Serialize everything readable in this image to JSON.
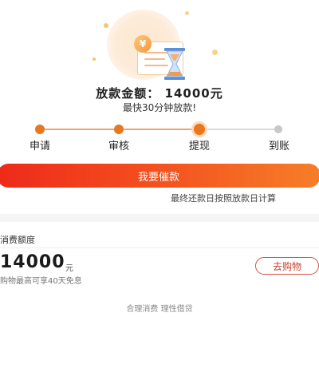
{
  "loan": {
    "amount_title": "放款金额：  14000元",
    "speed_note": "最快30分钟放款!"
  },
  "steps": [
    {
      "label": "申请",
      "state": "done"
    },
    {
      "label": "审核",
      "state": "done"
    },
    {
      "label": "提现",
      "state": "current"
    },
    {
      "label": "到账",
      "state": "pending"
    }
  ],
  "actions": {
    "urge_label": "我要催款",
    "repay_note": "最终还款日按照放款日计算"
  },
  "quota": {
    "label": "消费额度",
    "amount": "14000",
    "unit": "元",
    "desc": "购物最高可享40天免息",
    "shop_label": "去购物"
  },
  "footer": {
    "note": "合理消费  理性借贷"
  },
  "colors": {
    "accent": "#e8771f",
    "cta_start": "#ee2a1a",
    "cta_end": "#f67e28",
    "shop_border": "#d2533f"
  },
  "icons": {
    "hero": "loan-hourglass-illustration",
    "coin": "yen-coin-icon"
  }
}
